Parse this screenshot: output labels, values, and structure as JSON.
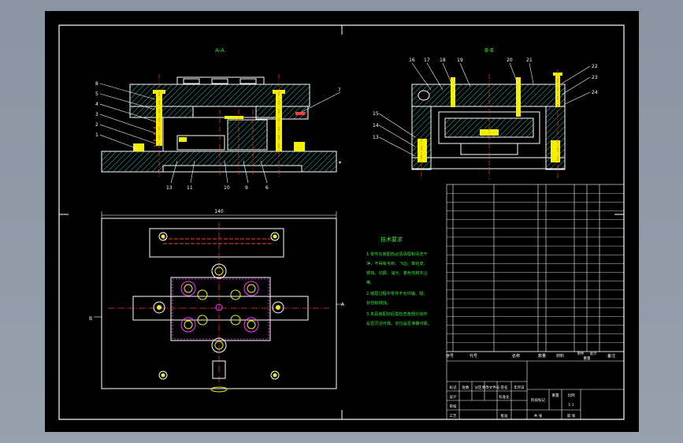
{
  "views": {
    "front_title": "A-A",
    "side_title": "B-B"
  },
  "front_balloons": [
    "8",
    "5",
    "4",
    "3",
    "2",
    "1",
    "7",
    "13",
    "11",
    "10",
    "9",
    "6"
  ],
  "side_balloons_top": [
    "16",
    "17",
    "18",
    "19",
    "20",
    "21"
  ],
  "side_balloons_right": [
    "22",
    "23",
    "24"
  ],
  "side_balloons_left": [
    "15",
    "14",
    "13"
  ],
  "dimension": {
    "plan_width": "140"
  },
  "section_marks": {
    "plan_left": "B",
    "plan_right": "A"
  },
  "tech_requirements": {
    "title": "技术要求",
    "lines": [
      "1.零件在装配前必须清理和清洗干",
      "净，不得有毛刺、飞边、氧化皮、",
      "锈蚀、切屑、油污、着色剂和灰尘",
      "等。",
      "2.装配过程中零件不允许磕、碰、",
      "划伤和锈蚀。",
      "3.夹具装配好后需检查各部分动作",
      "是否灵活可靠，定位是否准确可靠。"
    ]
  },
  "title_block": {
    "headers": [
      "序号",
      "代号",
      "名称",
      "数量",
      "材料",
      "单件",
      "总计",
      "重量",
      "备注"
    ],
    "cells": [
      "标记",
      "处数",
      "分区",
      "更改文件号",
      "签名",
      "年月日",
      "设计",
      "标准化",
      "阶段标记",
      "重量",
      "比例",
      "审核",
      "工艺",
      "批准",
      "共 张",
      "第 张",
      "1:1"
    ]
  },
  "colors": {
    "background": "#8f98a6",
    "drawing": "#000000",
    "outline": "#ffffff",
    "hatch": "#2fd6c8",
    "part": "#f2f200",
    "centerline": "#ff3b3b",
    "highlight": "#ff33ff",
    "text": "#35e835"
  }
}
